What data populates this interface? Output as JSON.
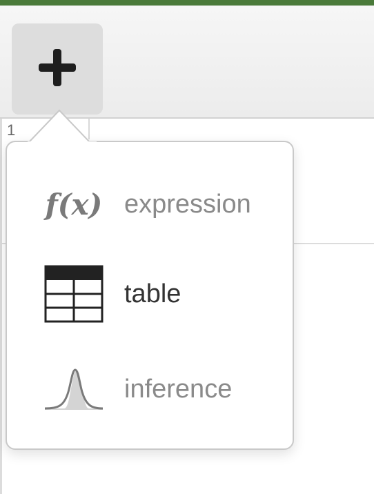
{
  "toolbar": {
    "add_button_icon": "plus-icon"
  },
  "expression_list": {
    "row_number": "1"
  },
  "add_menu": {
    "items": [
      {
        "label": "expression",
        "icon": "fx-icon",
        "glyph": "f(x)",
        "state": "muted"
      },
      {
        "label": "table",
        "icon": "table-icon",
        "state": "active"
      },
      {
        "label": "inference",
        "icon": "bell-curve-icon",
        "state": "muted"
      }
    ]
  },
  "colors": {
    "top_border": "#4a7a3a",
    "muted_text": "#8a8a8a",
    "active_text": "#333333"
  }
}
